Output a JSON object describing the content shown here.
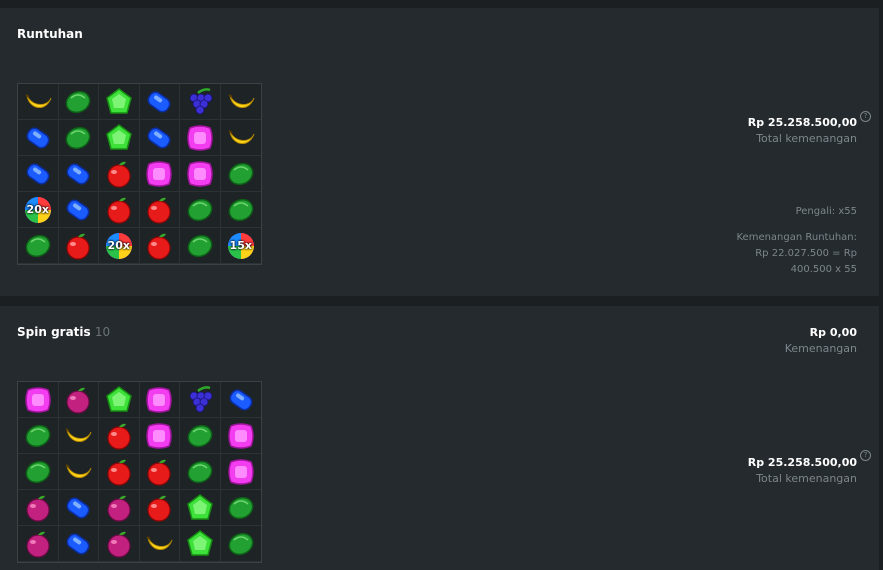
{
  "cascade": {
    "title": "Runtuhan",
    "total_amount": "Rp 25.258.500,00",
    "total_label": "Total kemenangan",
    "multiplier": "Pengali: x55",
    "cascade_win_label": "Kemenangan Runtuhan:",
    "cascade_win_line1": "Rp 22.027.500 = Rp",
    "cascade_win_line2": "400.500 x 55",
    "help": "?",
    "grid": [
      [
        "banana",
        "watermelon",
        "green-gem",
        "blue-gem",
        "grapes",
        "banana"
      ],
      [
        "blue-gem",
        "watermelon",
        "green-gem",
        "blue-gem",
        "pink-gem",
        "banana"
      ],
      [
        "blue-gem",
        "blue-gem",
        "apple",
        "pink-gem",
        "pink-gem",
        "watermelon"
      ],
      [
        "bomb:20x",
        "blue-gem",
        "apple",
        "apple",
        "watermelon",
        "watermelon"
      ],
      [
        "watermelon",
        "apple",
        "bomb:20x",
        "apple",
        "watermelon",
        "bomb:15x"
      ]
    ]
  },
  "free_spins": {
    "title": "Spin gratis",
    "count": "10",
    "win_amount": "Rp 0,00",
    "win_label": "Kemenangan",
    "total_amount": "Rp 25.258.500,00",
    "total_label": "Total kemenangan",
    "help": "?",
    "grid": [
      [
        "pink-gem",
        "plum",
        "green-gem",
        "pink-gem",
        "grapes",
        "blue-gem"
      ],
      [
        "watermelon",
        "banana",
        "apple",
        "pink-gem",
        "watermelon",
        "pink-gem"
      ],
      [
        "watermelon",
        "banana",
        "apple",
        "apple",
        "watermelon",
        "pink-gem"
      ],
      [
        "plum",
        "blue-gem",
        "plum",
        "apple",
        "green-gem",
        "watermelon"
      ],
      [
        "plum",
        "blue-gem",
        "plum",
        "banana",
        "green-gem",
        "watermelon"
      ]
    ]
  },
  "colors": {
    "panel": "#242a2e",
    "background": "#1b1f22",
    "muted": "#7d868b"
  }
}
